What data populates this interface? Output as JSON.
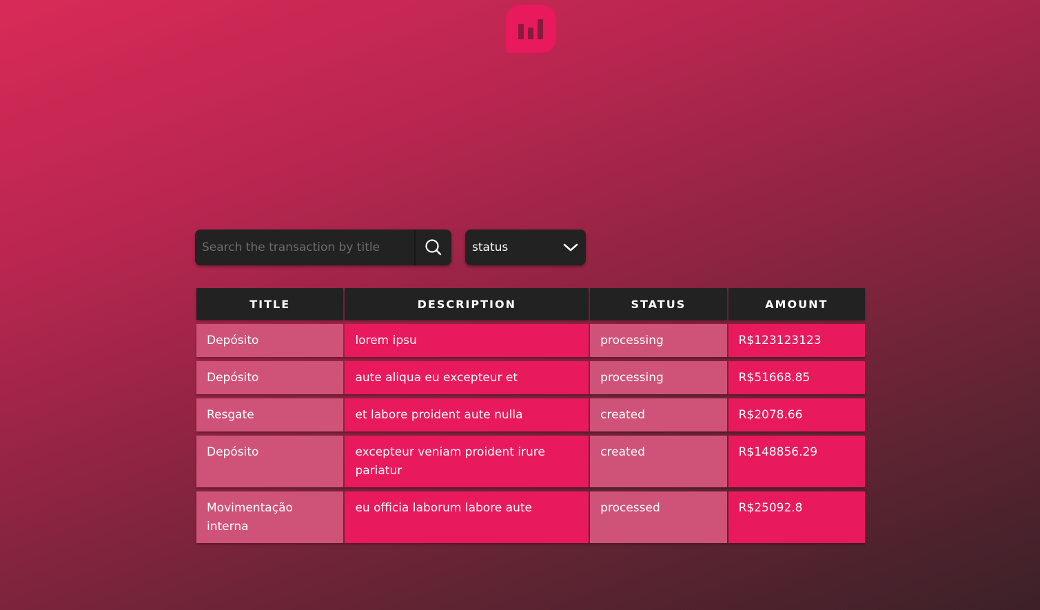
{
  "colors": {
    "accent": "#e8195d",
    "row_alt": "#cf5378",
    "dark": "#222222"
  },
  "logo": {
    "icon": "bar-chart-icon"
  },
  "search": {
    "placeholder": "Search the transaction by title",
    "value": "",
    "button_icon": "search-icon"
  },
  "filter": {
    "selected": "status",
    "icon": "chevron-down-icon"
  },
  "table": {
    "headers": [
      "TITLE",
      "DESCRIPTION",
      "STATUS",
      "AMOUNT"
    ],
    "rows": [
      {
        "title": "Depósito",
        "description": "lorem ipsu",
        "status": "processing",
        "amount": "R$123123123"
      },
      {
        "title": "Depósito",
        "description": "aute aliqua eu excepteur et",
        "status": "processing",
        "amount": "R$51668.85"
      },
      {
        "title": "Resgate",
        "description": "et labore proident aute nulla",
        "status": "created",
        "amount": "R$2078.66"
      },
      {
        "title": "Depósito",
        "description": "excepteur veniam proident irure pariatur",
        "status": "created",
        "amount": "R$148856.29"
      },
      {
        "title": "Movimentação interna",
        "description": "eu officia laborum labore aute",
        "status": "processed",
        "amount": "R$25092.8"
      }
    ]
  }
}
